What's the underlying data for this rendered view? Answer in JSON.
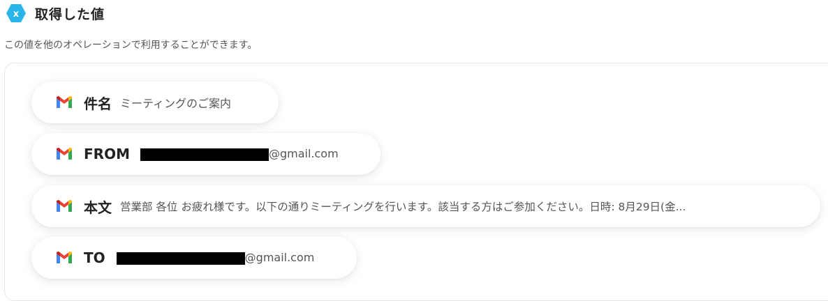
{
  "header": {
    "badge_icon": "x-hexagon-icon",
    "badge_color": "#2ab5e8",
    "title": "取得した値"
  },
  "subtitle": "この値を他のオペレーションで利用することができます。",
  "fields": [
    {
      "icon": "gmail-icon",
      "key": "件名",
      "value": "ミーティングのご案内"
    },
    {
      "icon": "gmail-icon",
      "key": "FROM",
      "value_suffix": "@gmail.com",
      "redacted": true
    },
    {
      "icon": "gmail-icon",
      "key": "本文",
      "value": "営業部 各位 お疲れ様です。以下の通りミーティングを行います。該当する方はご参加ください。日時: 8月29日(金..."
    },
    {
      "icon": "gmail-icon",
      "key": "TO",
      "value_suffix": "@gmail.com",
      "redacted": true
    }
  ]
}
